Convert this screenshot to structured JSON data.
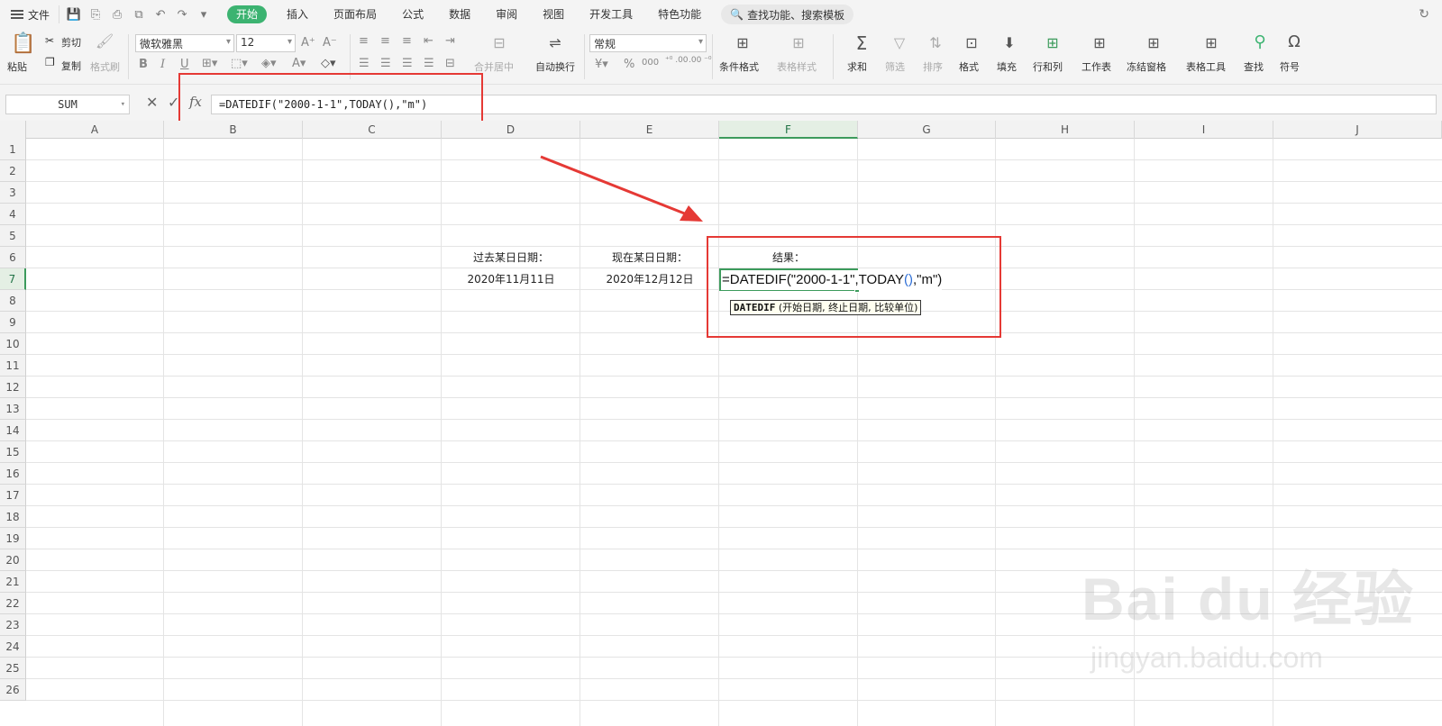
{
  "menubar": {
    "file_label": "文件",
    "tabs": [
      {
        "label": "开始",
        "active": true
      },
      {
        "label": "插入"
      },
      {
        "label": "页面布局"
      },
      {
        "label": "公式"
      },
      {
        "label": "数据"
      },
      {
        "label": "审阅"
      },
      {
        "label": "视图"
      },
      {
        "label": "开发工具"
      },
      {
        "label": "特色功能"
      }
    ],
    "search_placeholder": "查找功能、搜索模板"
  },
  "ribbon": {
    "paste": "粘贴",
    "cut": "剪切",
    "copy": "复制",
    "format_painter": "格式刷",
    "font_name": "微软雅黑",
    "font_size": "12",
    "merge_center": "合并居中",
    "wrap_text": "自动换行",
    "number_format": "常规",
    "conditional_format": "条件格式",
    "table_style": "表格样式",
    "sum": "求和",
    "filter": "筛选",
    "sort": "排序",
    "format": "格式",
    "fill": "填充",
    "row_col": "行和列",
    "worksheet": "工作表",
    "freeze": "冻结窗格",
    "table_tools": "表格工具",
    "find": "查找",
    "symbol": "符号"
  },
  "formula_bar": {
    "name_box": "SUM",
    "formula": "=DATEDIF(\"2000-1-1\",TODAY(),\"m\")"
  },
  "sheet": {
    "columns": [
      "A",
      "B",
      "C",
      "D",
      "E",
      "F",
      "G",
      "H",
      "I",
      "J"
    ],
    "selected_column": "F",
    "rows": [
      "1",
      "2",
      "3",
      "4",
      "5",
      "6",
      "7",
      "8",
      "9",
      "10",
      "11",
      "12",
      "13",
      "14",
      "15",
      "16",
      "17",
      "18",
      "19",
      "20",
      "21",
      "22",
      "23",
      "24",
      "25",
      "26"
    ],
    "selected_row": "7",
    "d6": "过去某日日期：",
    "e6": "现在某日日期：",
    "f6": "结果：",
    "d7": "2020年11月11日",
    "e7": "2020年12月12日",
    "edit": {
      "part1": "=DATEDIF(\"2000-1-1\",TODAY",
      "open_paren": "(",
      "close_paren": ")",
      "part2": ",\"m\")"
    },
    "tooltip_fn": "DATEDIF",
    "tooltip_args": " (开始日期, 终止日期, 比较单位)"
  },
  "watermark": {
    "brand": "Bai du 经验",
    "url": "jingyan.baidu.com"
  },
  "colors": {
    "accent_green": "#3cb371",
    "selection_green": "#3c9b5c",
    "annotation_red": "#e53935"
  }
}
